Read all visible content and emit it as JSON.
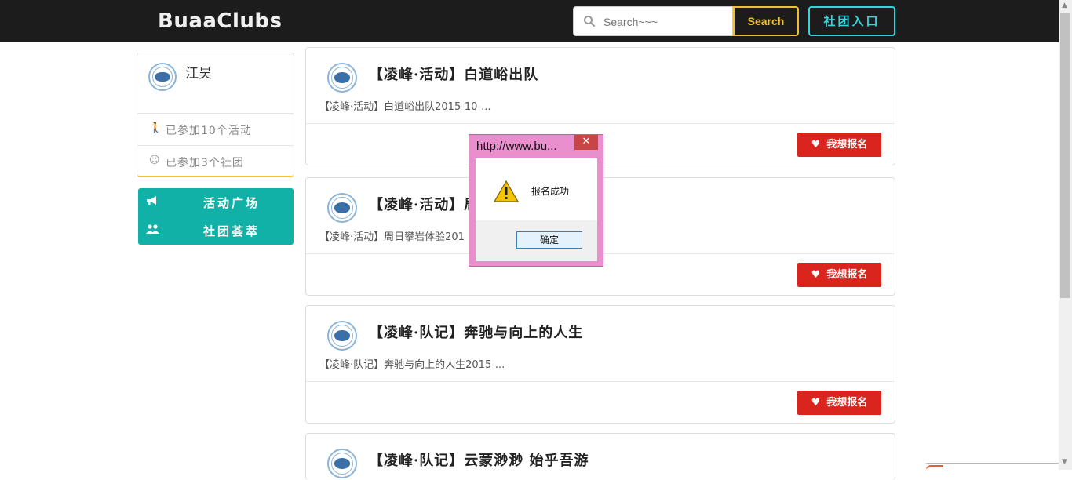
{
  "navbar": {
    "brand": "BuaaClubs",
    "search_placeholder": "Search~~~",
    "search_button": "Search",
    "club_entry_button": "社团入口"
  },
  "profile": {
    "name": "江昊",
    "activities_joined": "已参加10个活动",
    "clubs_joined": "已参加3个社团"
  },
  "menu": {
    "items": [
      {
        "label": "活动广场",
        "icon": "bullhorn-icon"
      },
      {
        "label": "社团荟萃",
        "icon": "users-icon"
      }
    ]
  },
  "activities": [
    {
      "title": "【凌峰·活动】白道峪出队",
      "desc": "【凌峰·活动】白道峪出队2015-10-...",
      "button": "我想报名"
    },
    {
      "title": "【凌峰·活动】周日攀岩体验",
      "title_visible": "【凌峰·活动】局",
      "desc": "【凌峰·活动】周日攀岩体验201",
      "button": "我想报名"
    },
    {
      "title": "【凌峰·队记】奔驰与向上的人生",
      "desc": "【凌峰·队记】奔驰与向上的人生2015-...",
      "button": "我想报名"
    },
    {
      "title": "【凌峰·队记】云蒙渺渺 始乎吾游",
      "desc": "",
      "button": "我想报名"
    }
  ],
  "dialog": {
    "title": "http://www.bu...",
    "close": "✕",
    "message": "报名成功",
    "ok_button": "确定"
  },
  "colors": {
    "navbar_bg": "#1c1c1c",
    "search_accent": "#f0c030",
    "club_entry_accent": "#34d6de",
    "menu_bg": "#11b1a8",
    "signup_button": "#d9251d",
    "dialog_frame": "#e98fcd"
  }
}
